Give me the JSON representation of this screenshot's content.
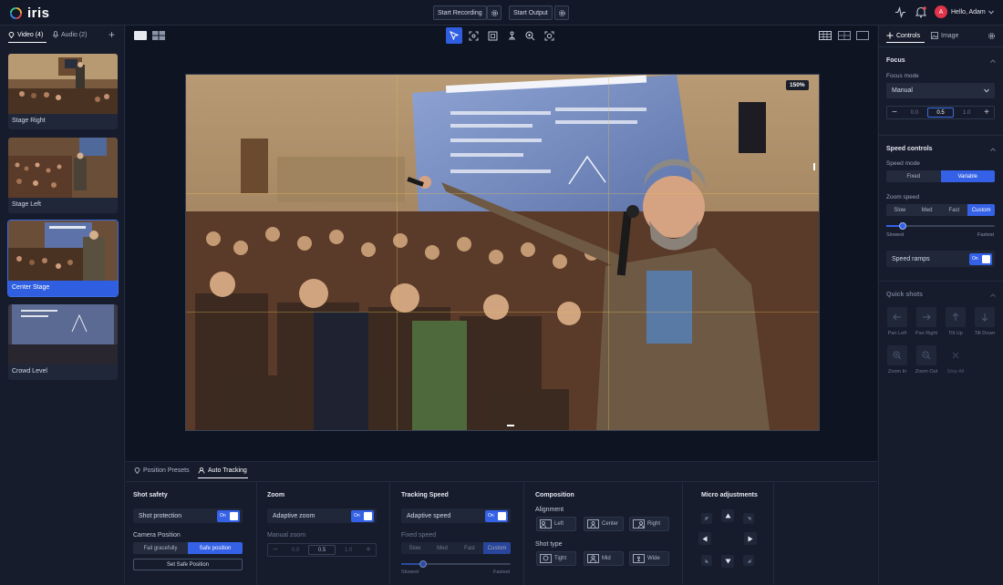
{
  "app": {
    "name": "iris"
  },
  "topbar": {
    "start_recording": "Start Recording",
    "start_output": "Start Output",
    "user_greeting": "Hello, Adam",
    "avatar_initial": "A"
  },
  "sidebar": {
    "tab_video": "Video (4)",
    "tab_audio": "Audio (2)",
    "sources": [
      {
        "label": "Stage Right"
      },
      {
        "label": "Stage Left"
      },
      {
        "label": "Center Stage",
        "selected": true
      },
      {
        "label": "Crowd Level"
      }
    ]
  },
  "preview": {
    "zoom_badge": "150%"
  },
  "right": {
    "tab_controls": "Controls",
    "tab_image": "Image",
    "focus": {
      "title": "Focus",
      "mode_label": "Focus mode",
      "mode_value": "Manual",
      "stepper_min": "0.0",
      "stepper_value": "0.5",
      "stepper_max": "1.0"
    },
    "speed": {
      "title": "Speed controls",
      "mode_label": "Speed mode",
      "mode_options": [
        "Fixed",
        "Variable"
      ],
      "zoom_speed_label": "Zoom speed",
      "zoom_options": [
        "Slow",
        "Med",
        "Fast",
        "Custom"
      ],
      "slider_min": "Slowest",
      "slider_max": "Fastest",
      "slider_value": 0.15,
      "ramps_label": "Speed ramps",
      "toggle_on": "On"
    },
    "quick": {
      "title": "Quick shots",
      "items": [
        "Pan Left",
        "Pan Right",
        "Tilt Up",
        "Tilt Down",
        "Zoom In",
        "Zoom Out",
        "Stop All"
      ]
    }
  },
  "bottom": {
    "tab_presets": "Position Presets",
    "tab_tracking": "Auto Tracking",
    "shot_safety": {
      "title": "Shot safety",
      "protection_label": "Shot protection",
      "toggle_on": "On",
      "camera_position_label": "Camera Position",
      "options": [
        "Fail gracefully",
        "Safe position"
      ],
      "set_safe": "Set Safe Position"
    },
    "zoom": {
      "title": "Zoom",
      "adaptive_label": "Adaptive zoom",
      "toggle_on": "On",
      "manual_label": "Manual zoom",
      "stepper_min": "0.0",
      "stepper_value": "0.5",
      "stepper_max": "1.0"
    },
    "tracking_speed": {
      "title": "Tracking Speed",
      "adaptive_label": "Adaptive speed",
      "toggle_on": "On",
      "fixed_label": "Fixed speed",
      "options": [
        "Slow",
        "Med",
        "Fast",
        "Custom"
      ],
      "slider_min": "Slowest",
      "slider_max": "Fastest",
      "slider_value": 0.2
    },
    "composition": {
      "title": "Composition",
      "alignment_label": "Alignment",
      "alignment": [
        "Left",
        "Center",
        "Right"
      ],
      "shot_type_label": "Shot type",
      "shot_types": [
        "Tight",
        "Mid",
        "Wide"
      ]
    },
    "micro": {
      "title": "Micro adjustments"
    }
  },
  "colors": {
    "accent": "#3461e6",
    "bg": "#141a2a",
    "panel": "#161c2c"
  }
}
